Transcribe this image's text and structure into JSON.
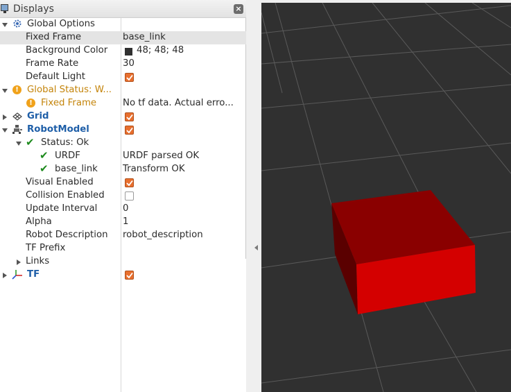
{
  "panel": {
    "title": "Displays",
    "close_label": "×"
  },
  "tree": {
    "global_options": {
      "label": "Global Options"
    },
    "fixed_frame": {
      "label": "Fixed Frame",
      "value": "base_link"
    },
    "background_color": {
      "label": "Background Color",
      "value": "48; 48; 48",
      "color": "#303030"
    },
    "frame_rate": {
      "label": "Frame Rate",
      "value": "30"
    },
    "default_light": {
      "label": "Default Light",
      "checked": true
    },
    "global_status": {
      "label": "Global Status: W...",
      "status": "warning"
    },
    "status_fixed_frame": {
      "label": "Fixed Frame",
      "value": "No tf data.  Actual erro..."
    },
    "grid": {
      "label": "Grid",
      "checked": true
    },
    "robot_model": {
      "label": "RobotModel",
      "checked": true
    },
    "status_ok": {
      "label": "Status: Ok"
    },
    "urdf": {
      "label": "URDF",
      "value": "URDF parsed OK"
    },
    "base_link": {
      "label": "base_link",
      "value": "Transform OK"
    },
    "visual_enabled": {
      "label": "Visual Enabled",
      "checked": true
    },
    "collision_enabled": {
      "label": "Collision Enabled",
      "checked": false
    },
    "update_interval": {
      "label": "Update Interval",
      "value": "0"
    },
    "alpha": {
      "label": "Alpha",
      "value": "1"
    },
    "robot_description": {
      "label": "Robot Description",
      "value": "robot_description"
    },
    "tf_prefix": {
      "label": "TF Prefix",
      "value": ""
    },
    "links": {
      "label": "Links"
    },
    "tf": {
      "label": "TF",
      "checked": true
    }
  },
  "colors": {
    "checkbox_orange": "#e86f2e",
    "warning_orange": "#f0a21b",
    "ok_green": "#1d8a1d",
    "display_blue": "#1f5fa8",
    "viewport_background": "#303030",
    "box_red": "#d40000"
  },
  "viewport": {
    "object": "red-box",
    "background": "48; 48; 48"
  }
}
